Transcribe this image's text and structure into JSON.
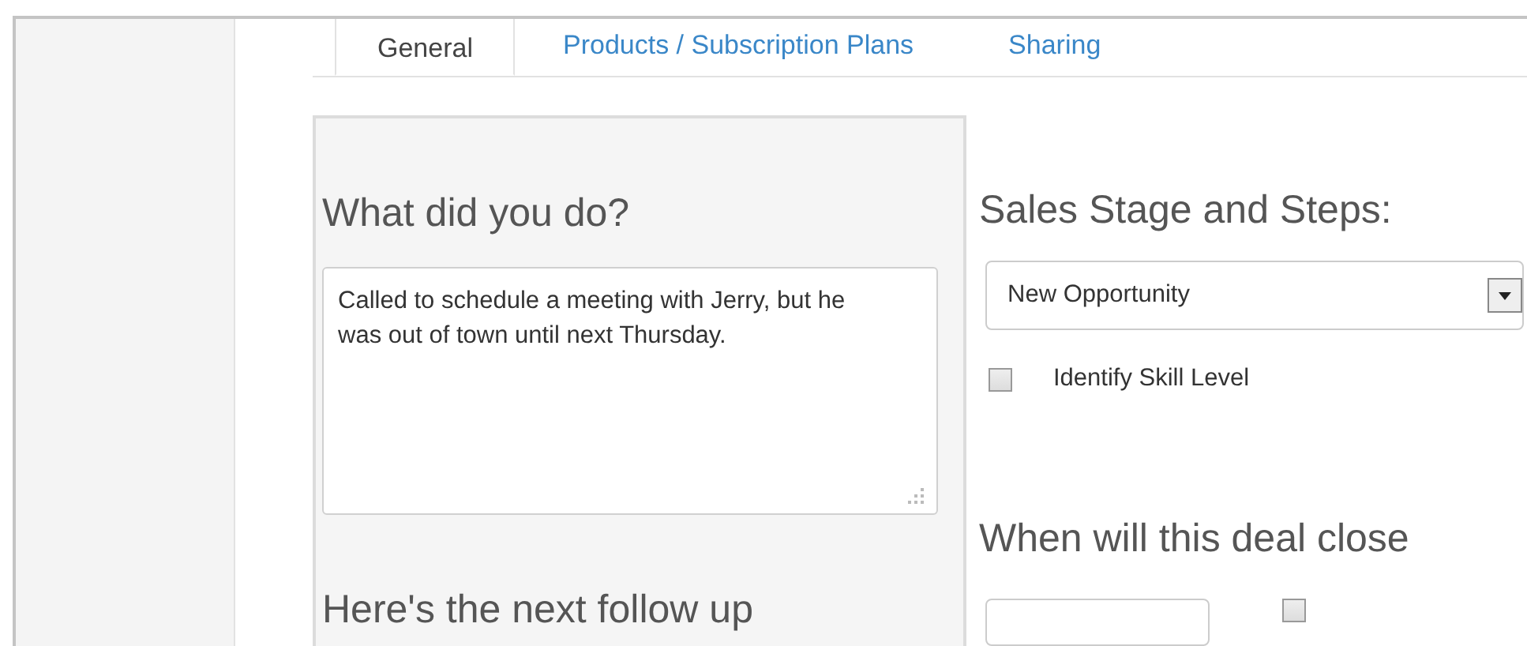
{
  "tabs": [
    {
      "label": "General",
      "selected": true
    },
    {
      "label": "Products / Subscription Plans",
      "selected": false
    },
    {
      "label": "Sharing",
      "selected": false
    }
  ],
  "activity": {
    "heading": "What did you do?",
    "notes": "Called to schedule a meeting with Jerry, but he was out of town until next Thursday.",
    "next_heading": "Here's the next follow up"
  },
  "sales_stage": {
    "heading": "Sales Stage and Steps:",
    "stage": "New Opportunity",
    "steps": [
      {
        "label": "Identify Skill Level",
        "checked": false
      }
    ]
  },
  "close": {
    "heading": "When will this deal close",
    "option_checked": false
  }
}
